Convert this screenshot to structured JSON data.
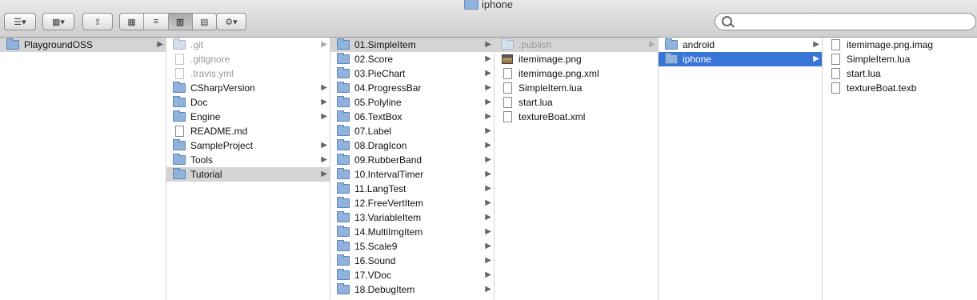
{
  "window": {
    "title": "iphone"
  },
  "toolbar": {
    "back_forward": "☰▾",
    "arrange": "▦▾",
    "share": "⇪",
    "views": [
      "▦",
      "≡",
      "▥",
      "▤"
    ],
    "action": "⚙▾"
  },
  "search": {
    "placeholder": "",
    "value": ""
  },
  "columns": [
    {
      "items": [
        {
          "label": "PlaygroundOSS",
          "kind": "folder",
          "chevron": true,
          "state": "sel"
        }
      ]
    },
    {
      "items": [
        {
          "label": ".git",
          "kind": "folder",
          "chevron": true,
          "state": "dim"
        },
        {
          "label": ".gitignore",
          "kind": "doc",
          "chevron": false,
          "state": "dim"
        },
        {
          "label": ".travis.yml",
          "kind": "doc",
          "chevron": false,
          "state": "dim"
        },
        {
          "label": "CSharpVersion",
          "kind": "folder",
          "chevron": true,
          "state": ""
        },
        {
          "label": "Doc",
          "kind": "folder",
          "chevron": true,
          "state": ""
        },
        {
          "label": "Engine",
          "kind": "folder",
          "chevron": true,
          "state": ""
        },
        {
          "label": "README.md",
          "kind": "doc",
          "chevron": false,
          "state": ""
        },
        {
          "label": "SampleProject",
          "kind": "folder",
          "chevron": true,
          "state": ""
        },
        {
          "label": "Tools",
          "kind": "folder",
          "chevron": true,
          "state": ""
        },
        {
          "label": "Tutorial",
          "kind": "folder",
          "chevron": true,
          "state": "sel"
        }
      ]
    },
    {
      "items": [
        {
          "label": "01.SimpleItem",
          "kind": "folder",
          "chevron": true,
          "state": "sel"
        },
        {
          "label": "02.Score",
          "kind": "folder",
          "chevron": true,
          "state": ""
        },
        {
          "label": "03.PieChart",
          "kind": "folder",
          "chevron": true,
          "state": ""
        },
        {
          "label": "04.ProgressBar",
          "kind": "folder",
          "chevron": true,
          "state": ""
        },
        {
          "label": "05.Polyline",
          "kind": "folder",
          "chevron": true,
          "state": ""
        },
        {
          "label": "06.TextBox",
          "kind": "folder",
          "chevron": true,
          "state": ""
        },
        {
          "label": "07.Label",
          "kind": "folder",
          "chevron": true,
          "state": ""
        },
        {
          "label": "08.DragIcon",
          "kind": "folder",
          "chevron": true,
          "state": ""
        },
        {
          "label": "09.RubberBand",
          "kind": "folder",
          "chevron": true,
          "state": ""
        },
        {
          "label": "10.IntervalTimer",
          "kind": "folder",
          "chevron": true,
          "state": ""
        },
        {
          "label": "11.LangTest",
          "kind": "folder",
          "chevron": true,
          "state": ""
        },
        {
          "label": "12.FreeVertItem",
          "kind": "folder",
          "chevron": true,
          "state": ""
        },
        {
          "label": "13.VariableItem",
          "kind": "folder",
          "chevron": true,
          "state": ""
        },
        {
          "label": "14.MultiImgItem",
          "kind": "folder",
          "chevron": true,
          "state": ""
        },
        {
          "label": "15.Scale9",
          "kind": "folder",
          "chevron": true,
          "state": ""
        },
        {
          "label": "16.Sound",
          "kind": "folder",
          "chevron": true,
          "state": ""
        },
        {
          "label": "17.VDoc",
          "kind": "folder",
          "chevron": true,
          "state": ""
        },
        {
          "label": "18.DebugItem",
          "kind": "folder",
          "chevron": true,
          "state": ""
        }
      ]
    },
    {
      "items": [
        {
          "label": ".publish",
          "kind": "folder",
          "chevron": true,
          "state": "sel dim"
        },
        {
          "label": "itemimage.png",
          "kind": "img",
          "chevron": false,
          "state": ""
        },
        {
          "label": "itemimage.png.xml",
          "kind": "doc",
          "chevron": false,
          "state": ""
        },
        {
          "label": "SimpleItem.lua",
          "kind": "doc",
          "chevron": false,
          "state": ""
        },
        {
          "label": "start.lua",
          "kind": "doc",
          "chevron": false,
          "state": ""
        },
        {
          "label": "textureBoat.xml",
          "kind": "doc",
          "chevron": false,
          "state": ""
        }
      ]
    },
    {
      "items": [
        {
          "label": "android",
          "kind": "folder",
          "chevron": true,
          "state": ""
        },
        {
          "label": "iphone",
          "kind": "folder",
          "chevron": true,
          "state": "selblue"
        }
      ]
    },
    {
      "items": [
        {
          "label": "itemimage.png.imag",
          "kind": "doc",
          "chevron": false,
          "state": ""
        },
        {
          "label": "SimpleItem.lua",
          "kind": "doc",
          "chevron": false,
          "state": ""
        },
        {
          "label": "start.lua",
          "kind": "doc",
          "chevron": false,
          "state": ""
        },
        {
          "label": "textureBoat.texb",
          "kind": "doc",
          "chevron": false,
          "state": ""
        }
      ]
    }
  ]
}
